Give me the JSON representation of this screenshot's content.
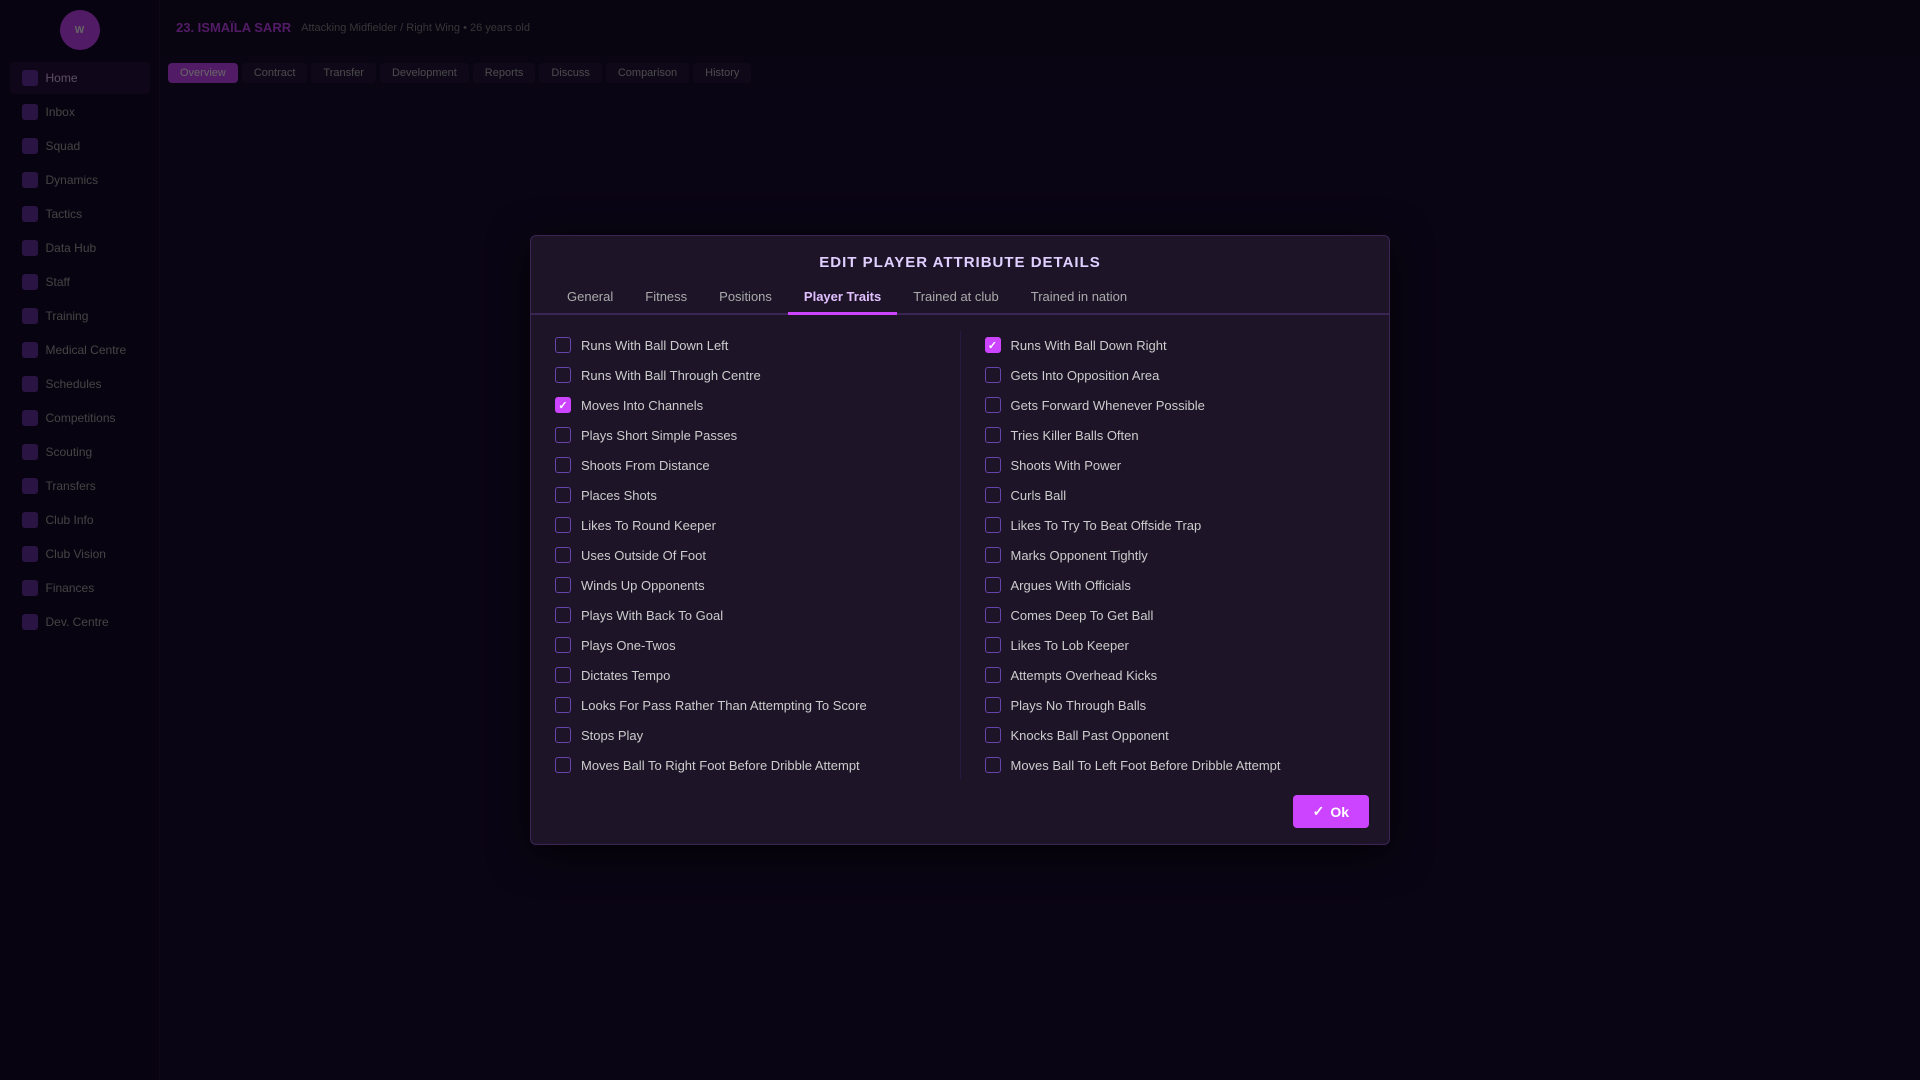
{
  "modal": {
    "title": "EDIT PLAYER ATTRIBUTE DETAILS",
    "tabs": [
      {
        "label": "General",
        "active": false
      },
      {
        "label": "Fitness",
        "active": false
      },
      {
        "label": "Positions",
        "active": false
      },
      {
        "label": "Player Traits",
        "active": true
      },
      {
        "label": "Trained at club",
        "active": false
      },
      {
        "label": "Trained in nation",
        "active": false
      }
    ],
    "ok_label": "Ok",
    "left_traits": [
      {
        "label": "Runs With Ball Down Left",
        "checked": false
      },
      {
        "label": "Runs With Ball Through Centre",
        "checked": false
      },
      {
        "label": "Moves Into Channels",
        "checked": true
      },
      {
        "label": "Plays Short Simple Passes",
        "checked": false
      },
      {
        "label": "Shoots From Distance",
        "checked": false
      },
      {
        "label": "Places Shots",
        "checked": false
      },
      {
        "label": "Likes To Round Keeper",
        "checked": false
      },
      {
        "label": "Uses Outside Of Foot",
        "checked": false
      },
      {
        "label": "Winds Up Opponents",
        "checked": false
      },
      {
        "label": "Plays With Back To Goal",
        "checked": false
      },
      {
        "label": "Plays One-Twos",
        "checked": false
      },
      {
        "label": "Dictates Tempo",
        "checked": false
      },
      {
        "label": "Looks For Pass Rather Than Attempting To Score",
        "checked": false
      },
      {
        "label": "Stops Play",
        "checked": false
      },
      {
        "label": "Moves Ball To Right Foot Before Dribble Attempt",
        "checked": false
      }
    ],
    "right_traits": [
      {
        "label": "Runs With Ball Down Right",
        "checked": true
      },
      {
        "label": "Gets Into Opposition Area",
        "checked": false
      },
      {
        "label": "Gets Forward Whenever Possible",
        "checked": false
      },
      {
        "label": "Tries Killer Balls Often",
        "checked": false
      },
      {
        "label": "Shoots With Power",
        "checked": false
      },
      {
        "label": "Curls Ball",
        "checked": false
      },
      {
        "label": "Likes To Try To Beat Offside Trap",
        "checked": false
      },
      {
        "label": "Marks Opponent Tightly",
        "checked": false
      },
      {
        "label": "Argues With Officials",
        "checked": false
      },
      {
        "label": "Comes Deep To Get Ball",
        "checked": false
      },
      {
        "label": "Likes To Lob Keeper",
        "checked": false
      },
      {
        "label": "Attempts Overhead Kicks",
        "checked": false
      },
      {
        "label": "Plays No Through Balls",
        "checked": false
      },
      {
        "label": "Knocks Ball Past Opponent",
        "checked": false
      },
      {
        "label": "Moves Ball To Left Foot Before Dribble Attempt",
        "checked": false
      }
    ]
  },
  "sidebar": {
    "items": [
      {
        "label": "Home",
        "icon": "home-icon"
      },
      {
        "label": "Inbox",
        "icon": "inbox-icon"
      },
      {
        "label": "Squad",
        "icon": "squad-icon"
      },
      {
        "label": "Dynamics",
        "icon": "dynamics-icon"
      },
      {
        "label": "Tactics",
        "icon": "tactics-icon"
      },
      {
        "label": "Data Hub",
        "icon": "data-icon"
      },
      {
        "label": "Staff",
        "icon": "staff-icon"
      },
      {
        "label": "Training",
        "icon": "training-icon"
      },
      {
        "label": "Medical Centre",
        "icon": "medical-icon"
      },
      {
        "label": "Schedules",
        "icon": "schedules-icon"
      },
      {
        "label": "Competitions",
        "icon": "competitions-icon"
      },
      {
        "label": "Scouting",
        "icon": "scouting-icon"
      },
      {
        "label": "Transfers",
        "icon": "transfers-icon"
      },
      {
        "label": "Club Info",
        "icon": "club-icon"
      },
      {
        "label": "Club Vision",
        "icon": "vision-icon"
      },
      {
        "label": "Finances",
        "icon": "finances-icon"
      },
      {
        "label": "Dev. Centre",
        "icon": "dev-icon"
      }
    ]
  }
}
